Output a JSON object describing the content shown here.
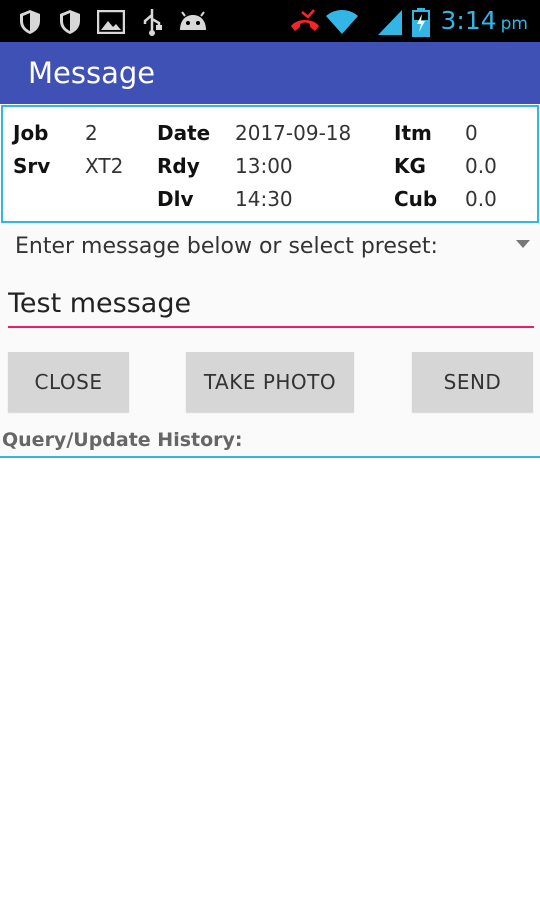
{
  "status_bar": {
    "time": "3:14",
    "ampm": "pm",
    "icons": [
      "shield-icon",
      "shield-icon",
      "image-icon",
      "usb-icon",
      "android-icon",
      "missed-call-icon",
      "wifi-icon",
      "signal-icon",
      "battery-charging-icon"
    ]
  },
  "header": {
    "title": "Message"
  },
  "info": {
    "job_label": "Job",
    "job_value": "2",
    "srv_label": "Srv",
    "srv_value": "XT2",
    "date_label": "Date",
    "date_value": "2017-09-18",
    "rdy_label": "Rdy",
    "rdy_value": "13:00",
    "dlv_label": "Dlv",
    "dlv_value": "14:30",
    "itm_label": "Itm",
    "itm_value": "0",
    "kg_label": "KG",
    "kg_value": "0.0",
    "cub_label": "Cub",
    "cub_value": "0.0"
  },
  "preset": {
    "label": "Enter message below or select preset:"
  },
  "message": {
    "value": "Test message"
  },
  "buttons": {
    "close": "CLOSE",
    "take_photo": "TAKE PHOTO",
    "send": "SEND"
  },
  "history": {
    "label": "Query/Update History:"
  },
  "colors": {
    "accent": "#3f51b5",
    "input_underline": "#e91e63",
    "border": "#33b5e5"
  }
}
